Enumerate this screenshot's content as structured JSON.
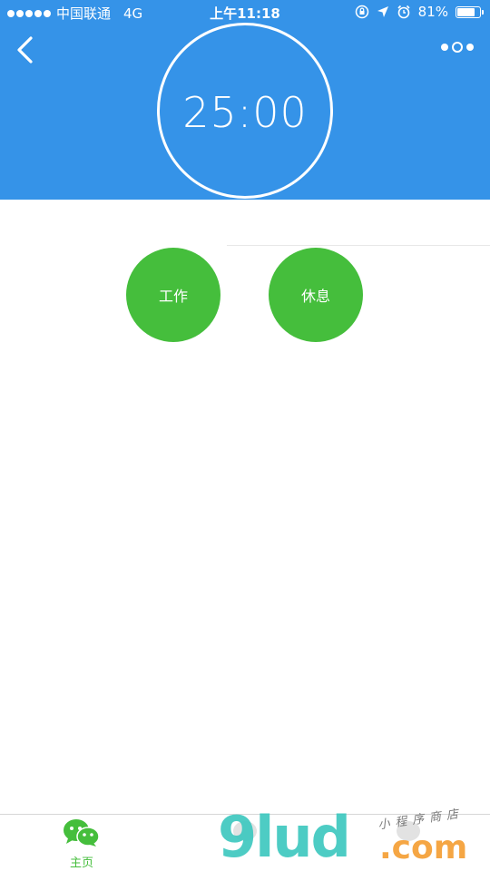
{
  "status_bar": {
    "carrier": "中国联通",
    "network": "4G",
    "time": "上午11:18",
    "battery": "81%",
    "battery_level": 0.81
  },
  "nav": {
    "back_icon": "chevron-left-icon",
    "more_icon": "more-dots-icon"
  },
  "timer": {
    "display": "25:00"
  },
  "buttons": {
    "work_label": "工作",
    "rest_label": "休息"
  },
  "tabbar": {
    "home_label": "主页",
    "home_icon": "wechat-icon"
  },
  "watermark": {
    "brand": "9lud",
    "domain": ".com",
    "tagline": "小程序商店"
  },
  "colors": {
    "header_blue": "#3593e8",
    "button_green": "#45be3c",
    "tab_active_green": "#45be3c"
  }
}
